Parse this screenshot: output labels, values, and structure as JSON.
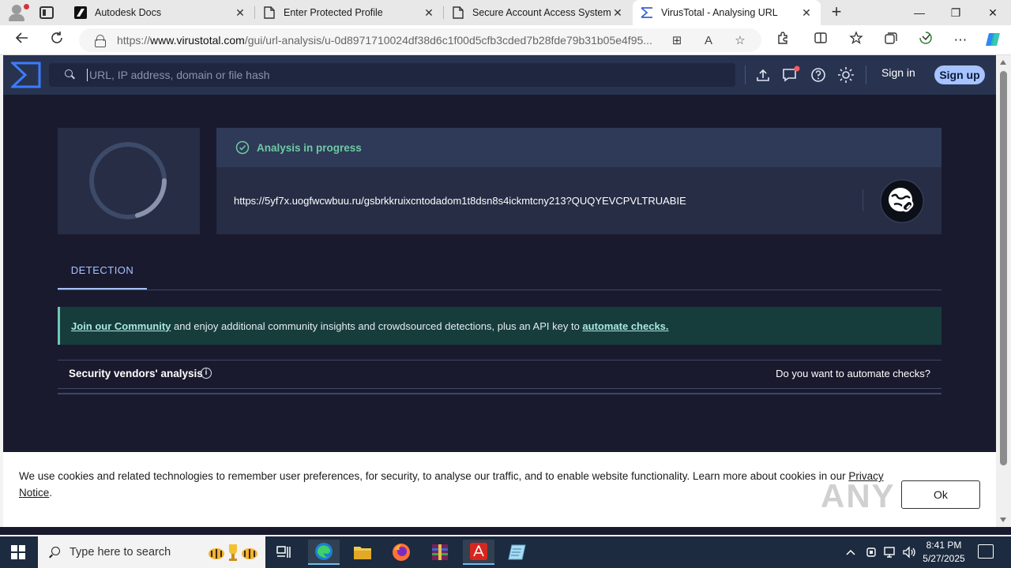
{
  "browser": {
    "tabs": [
      {
        "title": "Autodesk Docs"
      },
      {
        "title": "Enter Protected Profile"
      },
      {
        "title": "Secure Account Access System"
      },
      {
        "title": "VirusTotal - Analysing URL"
      }
    ],
    "url_prefix": "https://",
    "url_domain": "www.virustotal.com",
    "url_path": "/gui/url-analysis/u-0d8971710024df38d6c1f00d5cfb3cded7b28fde79b31b05e4f95..."
  },
  "vt": {
    "search_placeholder": "URL, IP address, domain or file hash",
    "signin": "Sign in",
    "signup": "Sign up",
    "status": "Analysis in progress",
    "analysed_url": "https://5yf7x.uogfwcwbuu.ru/gsbrkkruixcntodadom1t8dsn8s4ickmtcny213?QUQYEVCPVLTRUABIE",
    "tab_detection": "DETECTION",
    "community_link": "Join our Community",
    "community_text": " and enjoy additional community insights and crowdsourced detections, plus an API key to ",
    "community_link2": "automate checks.",
    "vendors_title": "Security vendors' analysis",
    "vendors_info": "i",
    "vendors_automate": "Do you want to automate checks?",
    "colors": {
      "accent": "#a7c3ff",
      "status_green": "#6fc9a3",
      "bg": "#1a1a2e",
      "header": "#283350"
    }
  },
  "cookie": {
    "text": "We use cookies and related technologies to remember user preferences, for security, to analyse our traffic, and to enable website functionality. Learn more about cookies in our ",
    "link": "Privacy Notice",
    "end": ".",
    "ok": "Ok",
    "watermark": "ANY RUN"
  },
  "taskbar": {
    "search_placeholder": "Type here to search",
    "time": "8:41 PM",
    "date": "5/27/2025"
  }
}
